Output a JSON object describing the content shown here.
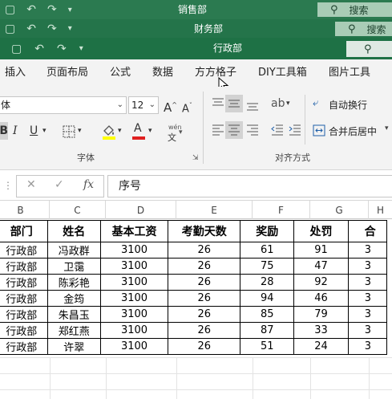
{
  "windows": [
    {
      "title": "销售部",
      "search": "搜索"
    },
    {
      "title": "财务部",
      "search": "搜索"
    },
    {
      "title": "行政部",
      "search": ""
    }
  ],
  "qa_icons": [
    "save-icon",
    "undo-icon",
    "redo-icon",
    "customize-icon"
  ],
  "tabs": [
    "插入",
    "页面布局",
    "公式",
    "数据",
    "方方格子",
    "DIY工具箱",
    "图片工具"
  ],
  "ribbon": {
    "font_name": "体",
    "font_size": "12",
    "grow_font": "A",
    "shrink_font": "A",
    "bold": "B",
    "italic": "I",
    "underline": "U",
    "wen": "wén",
    "font_color": "A",
    "wrap_text": "自动换行",
    "merge_center": "合并后居中",
    "font_group": "字体",
    "align_group": "对齐方式"
  },
  "formula_bar": {
    "cancel": "✕",
    "enter": "✓",
    "fx": "fx",
    "content": "序号"
  },
  "columns": [
    "B",
    "C",
    "D",
    "E",
    "F",
    "G",
    "H"
  ],
  "table": {
    "headers": [
      "部门",
      "姓名",
      "基本工资",
      "考勤天数",
      "奖励",
      "处罚",
      "合"
    ],
    "rows": [
      [
        "行政部",
        "冯政群",
        "3100",
        "26",
        "61",
        "91",
        "3"
      ],
      [
        "行政部",
        "卫霭",
        "3100",
        "26",
        "75",
        "47",
        "3"
      ],
      [
        "行政部",
        "陈彩艳",
        "3100",
        "26",
        "28",
        "92",
        "3"
      ],
      [
        "行政部",
        "金筠",
        "3100",
        "26",
        "94",
        "46",
        "3"
      ],
      [
        "行政部",
        "朱昌玉",
        "3100",
        "26",
        "85",
        "79",
        "3"
      ],
      [
        "行政部",
        "郑红燕",
        "3100",
        "26",
        "87",
        "33",
        "3"
      ],
      [
        "行政部",
        "许翠",
        "3100",
        "26",
        "51",
        "24",
        "3"
      ]
    ]
  },
  "colors": {
    "excel_green": "#1e7145",
    "ribbon_bg": "#f3f3f3",
    "highlight_yellow": "#ffff00",
    "font_red": "#e02020"
  }
}
